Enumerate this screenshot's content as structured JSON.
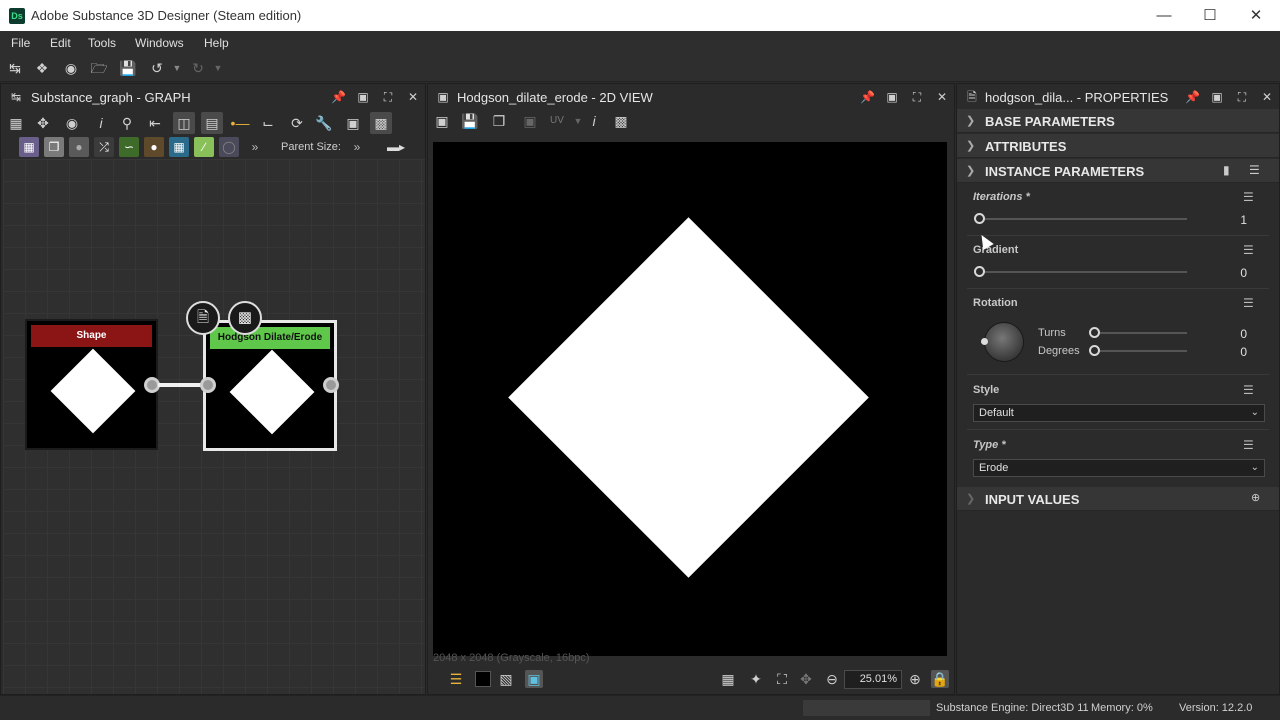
{
  "app": {
    "title": "Adobe Substance 3D Designer (Steam edition)",
    "logo_text": "Ds"
  },
  "menu": [
    "File",
    "Edit",
    "Tools",
    "Windows",
    "Help"
  ],
  "graph": {
    "title": "Substance_graph - GRAPH",
    "parent_size_label": "Parent Size:",
    "nodes": {
      "shape": "Shape",
      "dilate": "Hodgson Dilate/Erode"
    }
  },
  "view2d": {
    "title": "Hodgson_dilate_erode - 2D VIEW",
    "uv_label": "UV",
    "image_info": "2048 x 2048 (Grayscale, 16bpc)",
    "zoom": "25.01%"
  },
  "properties": {
    "title": "hodgson_dila... - PROPERTIES",
    "sections": {
      "base": "BASE PARAMETERS",
      "attributes": "ATTRIBUTES",
      "instance": "INSTANCE PARAMETERS",
      "inputs": "INPUT VALUES"
    },
    "iterations": {
      "label": "Iterations *",
      "value": "1"
    },
    "gradient": {
      "label": "Gradient",
      "value": "0"
    },
    "rotation": {
      "label": "Rotation",
      "turns_label": "Turns",
      "turns_value": "0",
      "degrees_label": "Degrees",
      "degrees_value": "0"
    },
    "style": {
      "label": "Style",
      "value": "Default"
    },
    "type": {
      "label": "Type *",
      "value": "Erode"
    }
  },
  "status": {
    "engine": "Substance Engine: Direct3D 11",
    "memory": "Memory: 0%",
    "version": "Version: 12.2.0"
  },
  "colors": {
    "shape_header": "#8b1515",
    "dilate_header": "#5fc84a",
    "panel_bg": "#2b2b2b"
  }
}
